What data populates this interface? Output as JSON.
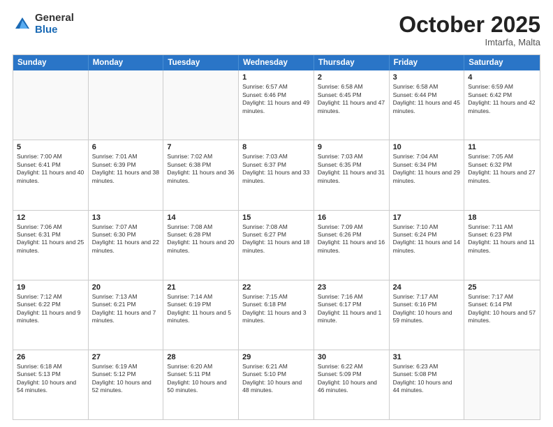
{
  "header": {
    "logo_general": "General",
    "logo_blue": "Blue",
    "month_title": "October 2025",
    "subtitle": "Imtarfa, Malta"
  },
  "days_of_week": [
    "Sunday",
    "Monday",
    "Tuesday",
    "Wednesday",
    "Thursday",
    "Friday",
    "Saturday"
  ],
  "weeks": [
    [
      {
        "day": "",
        "text": ""
      },
      {
        "day": "",
        "text": ""
      },
      {
        "day": "",
        "text": ""
      },
      {
        "day": "1",
        "text": "Sunrise: 6:57 AM\nSunset: 6:46 PM\nDaylight: 11 hours and 49 minutes."
      },
      {
        "day": "2",
        "text": "Sunrise: 6:58 AM\nSunset: 6:45 PM\nDaylight: 11 hours and 47 minutes."
      },
      {
        "day": "3",
        "text": "Sunrise: 6:58 AM\nSunset: 6:44 PM\nDaylight: 11 hours and 45 minutes."
      },
      {
        "day": "4",
        "text": "Sunrise: 6:59 AM\nSunset: 6:42 PM\nDaylight: 11 hours and 42 minutes."
      }
    ],
    [
      {
        "day": "5",
        "text": "Sunrise: 7:00 AM\nSunset: 6:41 PM\nDaylight: 11 hours and 40 minutes."
      },
      {
        "day": "6",
        "text": "Sunrise: 7:01 AM\nSunset: 6:39 PM\nDaylight: 11 hours and 38 minutes."
      },
      {
        "day": "7",
        "text": "Sunrise: 7:02 AM\nSunset: 6:38 PM\nDaylight: 11 hours and 36 minutes."
      },
      {
        "day": "8",
        "text": "Sunrise: 7:03 AM\nSunset: 6:37 PM\nDaylight: 11 hours and 33 minutes."
      },
      {
        "day": "9",
        "text": "Sunrise: 7:03 AM\nSunset: 6:35 PM\nDaylight: 11 hours and 31 minutes."
      },
      {
        "day": "10",
        "text": "Sunrise: 7:04 AM\nSunset: 6:34 PM\nDaylight: 11 hours and 29 minutes."
      },
      {
        "day": "11",
        "text": "Sunrise: 7:05 AM\nSunset: 6:32 PM\nDaylight: 11 hours and 27 minutes."
      }
    ],
    [
      {
        "day": "12",
        "text": "Sunrise: 7:06 AM\nSunset: 6:31 PM\nDaylight: 11 hours and 25 minutes."
      },
      {
        "day": "13",
        "text": "Sunrise: 7:07 AM\nSunset: 6:30 PM\nDaylight: 11 hours and 22 minutes."
      },
      {
        "day": "14",
        "text": "Sunrise: 7:08 AM\nSunset: 6:28 PM\nDaylight: 11 hours and 20 minutes."
      },
      {
        "day": "15",
        "text": "Sunrise: 7:08 AM\nSunset: 6:27 PM\nDaylight: 11 hours and 18 minutes."
      },
      {
        "day": "16",
        "text": "Sunrise: 7:09 AM\nSunset: 6:26 PM\nDaylight: 11 hours and 16 minutes."
      },
      {
        "day": "17",
        "text": "Sunrise: 7:10 AM\nSunset: 6:24 PM\nDaylight: 11 hours and 14 minutes."
      },
      {
        "day": "18",
        "text": "Sunrise: 7:11 AM\nSunset: 6:23 PM\nDaylight: 11 hours and 11 minutes."
      }
    ],
    [
      {
        "day": "19",
        "text": "Sunrise: 7:12 AM\nSunset: 6:22 PM\nDaylight: 11 hours and 9 minutes."
      },
      {
        "day": "20",
        "text": "Sunrise: 7:13 AM\nSunset: 6:21 PM\nDaylight: 11 hours and 7 minutes."
      },
      {
        "day": "21",
        "text": "Sunrise: 7:14 AM\nSunset: 6:19 PM\nDaylight: 11 hours and 5 minutes."
      },
      {
        "day": "22",
        "text": "Sunrise: 7:15 AM\nSunset: 6:18 PM\nDaylight: 11 hours and 3 minutes."
      },
      {
        "day": "23",
        "text": "Sunrise: 7:16 AM\nSunset: 6:17 PM\nDaylight: 11 hours and 1 minute."
      },
      {
        "day": "24",
        "text": "Sunrise: 7:17 AM\nSunset: 6:16 PM\nDaylight: 10 hours and 59 minutes."
      },
      {
        "day": "25",
        "text": "Sunrise: 7:17 AM\nSunset: 6:14 PM\nDaylight: 10 hours and 57 minutes."
      }
    ],
    [
      {
        "day": "26",
        "text": "Sunrise: 6:18 AM\nSunset: 5:13 PM\nDaylight: 10 hours and 54 minutes."
      },
      {
        "day": "27",
        "text": "Sunrise: 6:19 AM\nSunset: 5:12 PM\nDaylight: 10 hours and 52 minutes."
      },
      {
        "day": "28",
        "text": "Sunrise: 6:20 AM\nSunset: 5:11 PM\nDaylight: 10 hours and 50 minutes."
      },
      {
        "day": "29",
        "text": "Sunrise: 6:21 AM\nSunset: 5:10 PM\nDaylight: 10 hours and 48 minutes."
      },
      {
        "day": "30",
        "text": "Sunrise: 6:22 AM\nSunset: 5:09 PM\nDaylight: 10 hours and 46 minutes."
      },
      {
        "day": "31",
        "text": "Sunrise: 6:23 AM\nSunset: 5:08 PM\nDaylight: 10 hours and 44 minutes."
      },
      {
        "day": "",
        "text": ""
      }
    ]
  ]
}
